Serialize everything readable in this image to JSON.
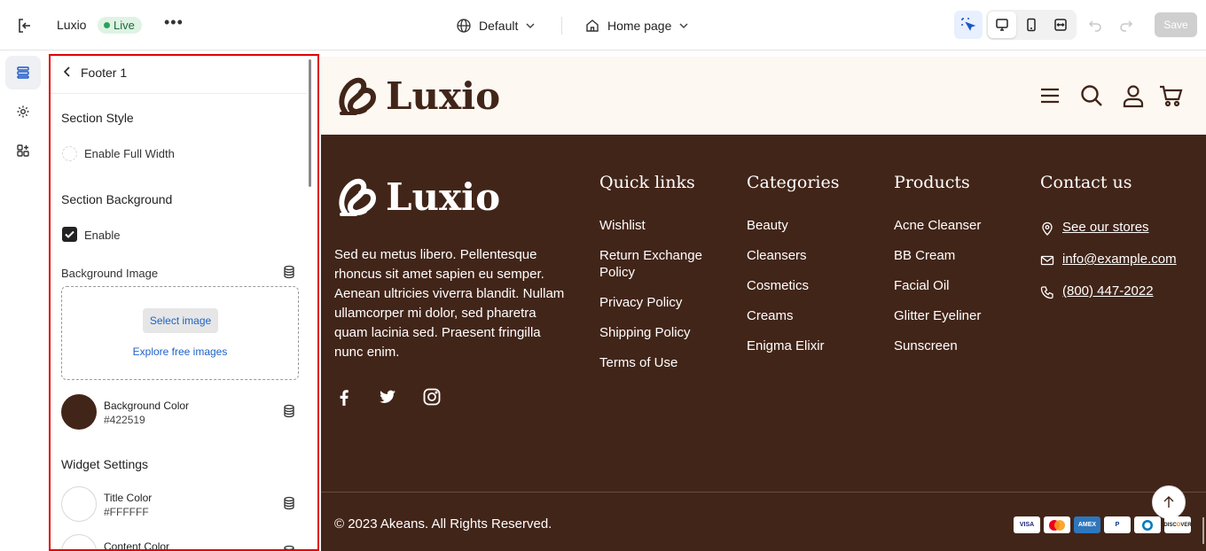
{
  "topbar": {
    "store_name": "Luxio",
    "status_badge": "Live",
    "more_icon": "more-horizontal-icon",
    "theme_label": "Default",
    "page_label": "Home page",
    "save_label": "Save"
  },
  "rail": {
    "items": [
      {
        "icon": "sections-icon",
        "active": true
      },
      {
        "icon": "settings-gear-icon",
        "active": false
      },
      {
        "icon": "apps-icon",
        "active": false
      }
    ]
  },
  "panel": {
    "title": "Footer 1",
    "section_style_heading": "Section Style",
    "full_width_label": "Enable Full Width",
    "full_width_checked": false,
    "section_background_heading": "Section Background",
    "enable_label": "Enable",
    "enable_checked": true,
    "background_image_label": "Background Image",
    "select_image_label": "Select image",
    "explore_label": "Explore free images",
    "background_color_label": "Background Color",
    "background_color_value": "#422519",
    "widget_settings_heading": "Widget Settings",
    "title_color_label": "Title Color",
    "title_color_value": "#FFFFFF",
    "content_color_label": "Content Color"
  },
  "preview": {
    "brand": "Luxio",
    "about_text": "Sed eu metus libero. Pellentesque rhoncus sit amet sapien eu semper. Aenean ultricies viverra blandit. Nullam ullamcorper mi dolor, sed pharetra quam lacinia sed. Praesent fringilla nunc enim.",
    "columns": [
      {
        "title": "Quick links",
        "links": [
          "Wishlist",
          "Return Exchange Policy",
          "Privacy Policy",
          "Shipping Policy",
          "Terms of Use"
        ]
      },
      {
        "title": "Categories",
        "links": [
          "Beauty",
          "Cleansers",
          "Cosmetics",
          "Creams",
          "Enigma Elixir"
        ]
      },
      {
        "title": "Products",
        "links": [
          "Acne Cleanser",
          "BB Cream",
          "Facial Oil",
          "Glitter Eyeliner",
          "Sunscreen"
        ]
      },
      {
        "title": "Contact us",
        "links": [
          "See our stores",
          "info@example.com",
          "(800) 447-2022"
        ]
      }
    ],
    "social": [
      "facebook-icon",
      "twitter-icon",
      "instagram-icon"
    ],
    "copyright": "© 2023 Akeans. All Rights Reserved.",
    "payments": [
      "VISA",
      "Mastercard",
      "AMEX",
      "PayPal",
      "Diners",
      "DISCOVER"
    ],
    "colors": {
      "footer_bg": "#422519",
      "header_bg": "#fdf8f2",
      "brand": "#422519"
    }
  }
}
